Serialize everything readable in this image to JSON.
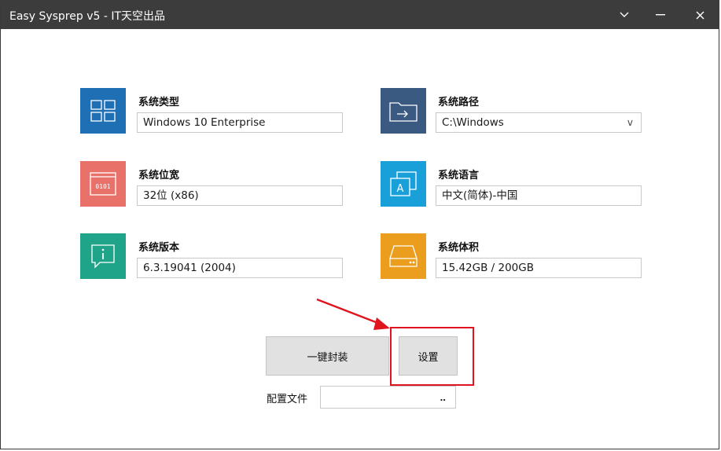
{
  "window": {
    "title": "Easy Sysprep v5 - IT天空出品",
    "controls": {
      "dropdown": "∨",
      "minimize": "—",
      "close": "X"
    }
  },
  "fields": [
    {
      "id": "system-type",
      "label": "系统类型",
      "value": "Windows 10 Enterprise",
      "icon": "windows-tiles-icon",
      "color": "#1f6fb5"
    },
    {
      "id": "system-path",
      "label": "系统路径",
      "value": "C:\\Windows",
      "dropdown": "v",
      "icon": "folder-arrow-icon",
      "color": "#3a5a82"
    },
    {
      "id": "system-bits",
      "label": "系统位宽",
      "value": "32位 (x86)",
      "icon": "binary-window-icon",
      "color": "#e8726a"
    },
    {
      "id": "system-language",
      "label": "系统语言",
      "value": "中文(简体)-中国",
      "icon": "language-icon",
      "color": "#1aa0d8"
    },
    {
      "id": "system-version",
      "label": "系统版本",
      "value": "6.3.19041 (2004)",
      "icon": "info-bubble-icon",
      "color": "#1fa48a"
    },
    {
      "id": "system-size",
      "label": "系统体积",
      "value": "15.42GB / 200GB",
      "icon": "hard-drive-icon",
      "color": "#eb9d1e"
    }
  ],
  "actions": {
    "package_label": "一键封装",
    "settings_label": "设置"
  },
  "config": {
    "label": "配置文件",
    "value": "",
    "browse": "‥"
  },
  "colors": {
    "titlebar": "#3c3c3c",
    "highlight": "#e0141e"
  }
}
